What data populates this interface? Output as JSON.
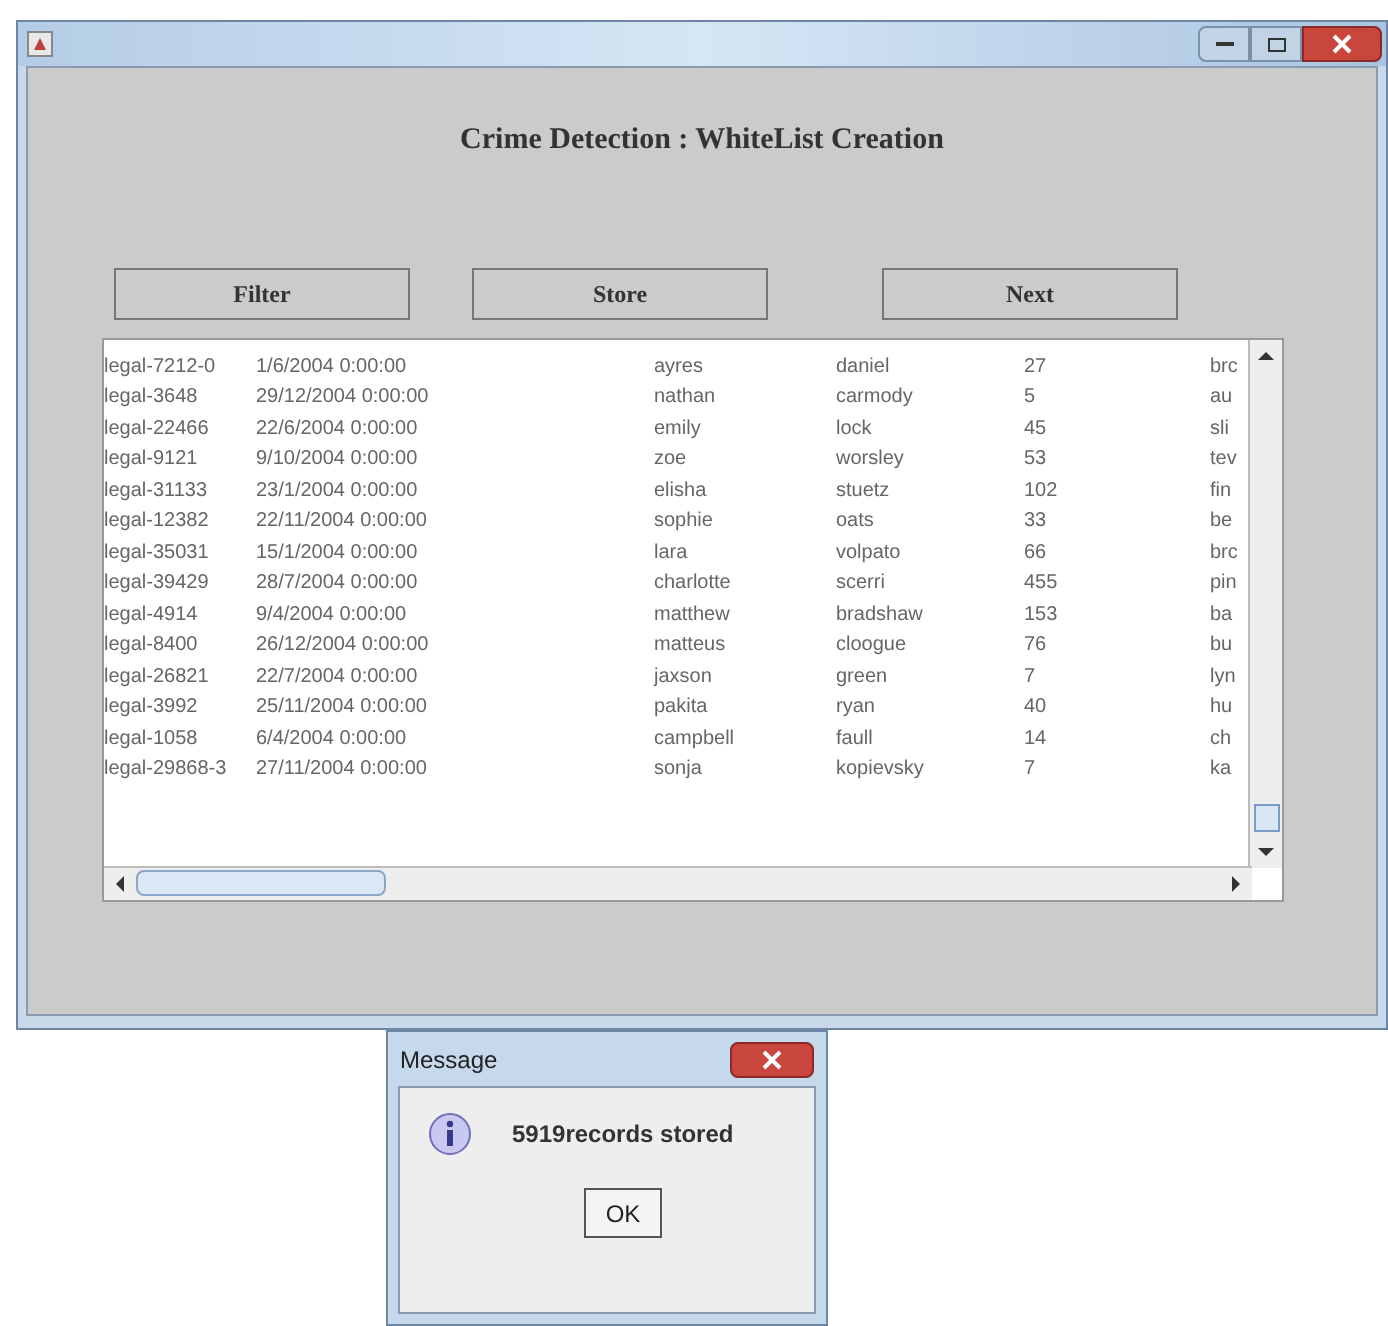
{
  "window": {
    "heading": "Crime Detection : WhiteList Creation"
  },
  "buttons": [
    "Filter",
    "Store",
    "Next"
  ],
  "table": {
    "rows": [
      [
        "legal-7212-0",
        "1/6/2004 0:00:00",
        "ayres",
        "daniel",
        "27",
        "brc"
      ],
      [
        "legal-3648",
        "29/12/2004 0:00:00",
        "nathan",
        "carmody",
        "5",
        "au"
      ],
      [
        "legal-22466",
        "22/6/2004 0:00:00",
        "emily",
        "lock",
        "45",
        "sli"
      ],
      [
        "legal-9121",
        "9/10/2004 0:00:00",
        "zoe",
        "worsley",
        "53",
        "tev"
      ],
      [
        "legal-31133",
        "23/1/2004 0:00:00",
        "elisha",
        "stuetz",
        "102",
        "fin"
      ],
      [
        "legal-12382",
        "22/11/2004 0:00:00",
        "sophie",
        "oats",
        "33",
        "be"
      ],
      [
        "legal-35031",
        "15/1/2004 0:00:00",
        "lara",
        "volpato",
        "66",
        "brc"
      ],
      [
        "legal-39429",
        "28/7/2004 0:00:00",
        "charlotte",
        "scerri",
        "455",
        "pin"
      ],
      [
        "legal-4914",
        "9/4/2004 0:00:00",
        "matthew",
        "bradshaw",
        "153",
        "ba"
      ],
      [
        "legal-8400",
        "26/12/2004 0:00:00",
        "matteus",
        "cloogue",
        "76",
        "bu"
      ],
      [
        "legal-26821",
        "22/7/2004 0:00:00",
        "jaxson",
        "green",
        "7",
        "lyn"
      ],
      [
        "legal-3992",
        "25/11/2004 0:00:00",
        "pakita",
        "ryan",
        "40",
        "hu"
      ],
      [
        "legal-1058",
        "6/4/2004 0:00:00",
        "campbell",
        "faull",
        "14",
        "ch"
      ],
      [
        "legal-29868-3",
        "27/11/2004 0:00:00",
        "sonja",
        "kopievsky",
        "7",
        "ka"
      ]
    ]
  },
  "dialog": {
    "title": "Message",
    "message": "5919records stored",
    "button": "OK"
  }
}
